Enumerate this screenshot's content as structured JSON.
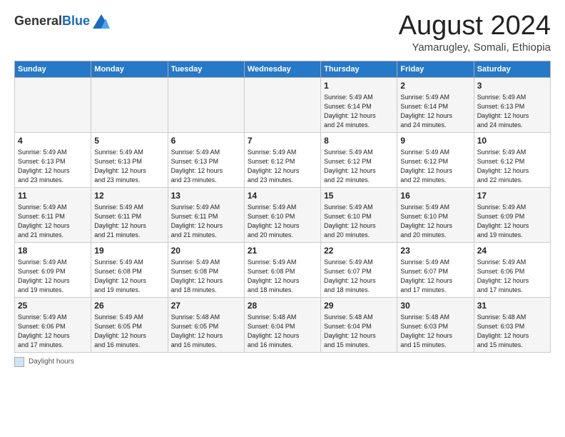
{
  "header": {
    "logo_general": "General",
    "logo_blue": "Blue",
    "month_title": "August 2024",
    "location": "Yamarugley, Somali, Ethiopia"
  },
  "weekdays": [
    "Sunday",
    "Monday",
    "Tuesday",
    "Wednesday",
    "Thursday",
    "Friday",
    "Saturday"
  ],
  "weeks": [
    [
      {
        "day": "",
        "info": ""
      },
      {
        "day": "",
        "info": ""
      },
      {
        "day": "",
        "info": ""
      },
      {
        "day": "",
        "info": ""
      },
      {
        "day": "1",
        "info": "Sunrise: 5:49 AM\nSunset: 6:14 PM\nDaylight: 12 hours\nand 24 minutes."
      },
      {
        "day": "2",
        "info": "Sunrise: 5:49 AM\nSunset: 6:14 PM\nDaylight: 12 hours\nand 24 minutes."
      },
      {
        "day": "3",
        "info": "Sunrise: 5:49 AM\nSunset: 6:13 PM\nDaylight: 12 hours\nand 24 minutes."
      }
    ],
    [
      {
        "day": "4",
        "info": "Sunrise: 5:49 AM\nSunset: 6:13 PM\nDaylight: 12 hours\nand 23 minutes."
      },
      {
        "day": "5",
        "info": "Sunrise: 5:49 AM\nSunset: 6:13 PM\nDaylight: 12 hours\nand 23 minutes."
      },
      {
        "day": "6",
        "info": "Sunrise: 5:49 AM\nSunset: 6:13 PM\nDaylight: 12 hours\nand 23 minutes."
      },
      {
        "day": "7",
        "info": "Sunrise: 5:49 AM\nSunset: 6:12 PM\nDaylight: 12 hours\nand 23 minutes."
      },
      {
        "day": "8",
        "info": "Sunrise: 5:49 AM\nSunset: 6:12 PM\nDaylight: 12 hours\nand 22 minutes."
      },
      {
        "day": "9",
        "info": "Sunrise: 5:49 AM\nSunset: 6:12 PM\nDaylight: 12 hours\nand 22 minutes."
      },
      {
        "day": "10",
        "info": "Sunrise: 5:49 AM\nSunset: 6:12 PM\nDaylight: 12 hours\nand 22 minutes."
      }
    ],
    [
      {
        "day": "11",
        "info": "Sunrise: 5:49 AM\nSunset: 6:11 PM\nDaylight: 12 hours\nand 21 minutes."
      },
      {
        "day": "12",
        "info": "Sunrise: 5:49 AM\nSunset: 6:11 PM\nDaylight: 12 hours\nand 21 minutes."
      },
      {
        "day": "13",
        "info": "Sunrise: 5:49 AM\nSunset: 6:11 PM\nDaylight: 12 hours\nand 21 minutes."
      },
      {
        "day": "14",
        "info": "Sunrise: 5:49 AM\nSunset: 6:10 PM\nDaylight: 12 hours\nand 20 minutes."
      },
      {
        "day": "15",
        "info": "Sunrise: 5:49 AM\nSunset: 6:10 PM\nDaylight: 12 hours\nand 20 minutes."
      },
      {
        "day": "16",
        "info": "Sunrise: 5:49 AM\nSunset: 6:10 PM\nDaylight: 12 hours\nand 20 minutes."
      },
      {
        "day": "17",
        "info": "Sunrise: 5:49 AM\nSunset: 6:09 PM\nDaylight: 12 hours\nand 19 minutes."
      }
    ],
    [
      {
        "day": "18",
        "info": "Sunrise: 5:49 AM\nSunset: 6:09 PM\nDaylight: 12 hours\nand 19 minutes."
      },
      {
        "day": "19",
        "info": "Sunrise: 5:49 AM\nSunset: 6:08 PM\nDaylight: 12 hours\nand 19 minutes."
      },
      {
        "day": "20",
        "info": "Sunrise: 5:49 AM\nSunset: 6:08 PM\nDaylight: 12 hours\nand 18 minutes."
      },
      {
        "day": "21",
        "info": "Sunrise: 5:49 AM\nSunset: 6:08 PM\nDaylight: 12 hours\nand 18 minutes."
      },
      {
        "day": "22",
        "info": "Sunrise: 5:49 AM\nSunset: 6:07 PM\nDaylight: 12 hours\nand 18 minutes."
      },
      {
        "day": "23",
        "info": "Sunrise: 5:49 AM\nSunset: 6:07 PM\nDaylight: 12 hours\nand 17 minutes."
      },
      {
        "day": "24",
        "info": "Sunrise: 5:49 AM\nSunset: 6:06 PM\nDaylight: 12 hours\nand 17 minutes."
      }
    ],
    [
      {
        "day": "25",
        "info": "Sunrise: 5:49 AM\nSunset: 6:06 PM\nDaylight: 12 hours\nand 17 minutes."
      },
      {
        "day": "26",
        "info": "Sunrise: 5:49 AM\nSunset: 6:05 PM\nDaylight: 12 hours\nand 16 minutes."
      },
      {
        "day": "27",
        "info": "Sunrise: 5:48 AM\nSunset: 6:05 PM\nDaylight: 12 hours\nand 16 minutes."
      },
      {
        "day": "28",
        "info": "Sunrise: 5:48 AM\nSunset: 6:04 PM\nDaylight: 12 hours\nand 16 minutes."
      },
      {
        "day": "29",
        "info": "Sunrise: 5:48 AM\nSunset: 6:04 PM\nDaylight: 12 hours\nand 15 minutes."
      },
      {
        "day": "30",
        "info": "Sunrise: 5:48 AM\nSunset: 6:03 PM\nDaylight: 12 hours\nand 15 minutes."
      },
      {
        "day": "31",
        "info": "Sunrise: 5:48 AM\nSunset: 6:03 PM\nDaylight: 12 hours\nand 15 minutes."
      }
    ]
  ],
  "footer": {
    "label": "Daylight hours"
  }
}
